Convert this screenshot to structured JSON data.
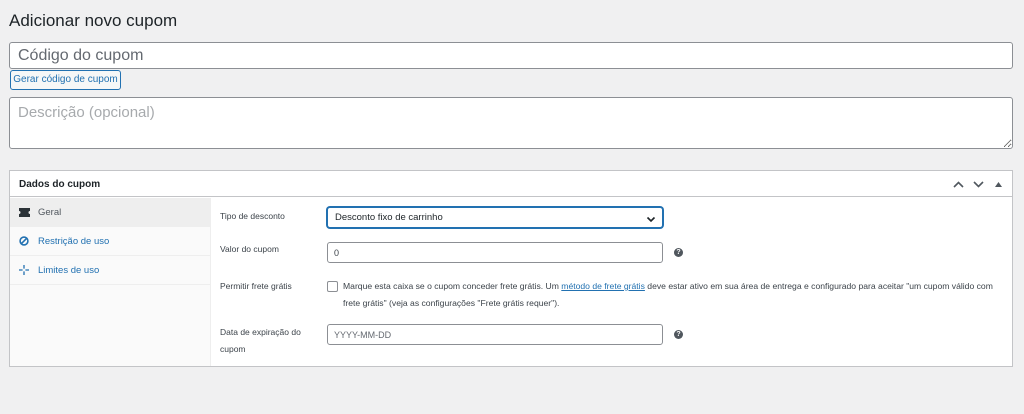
{
  "page": {
    "title": "Adicionar novo cupom",
    "code_placeholder": "Código do cupom",
    "generate_button": "Gerar código de cupom",
    "description_placeholder": "Descrição (opcional)"
  },
  "metabox": {
    "title": "Dados do cupom",
    "controls": [
      "chevron-up-icon",
      "chevron-down-icon",
      "triangle-up-icon"
    ]
  },
  "tabs": [
    {
      "label": "Geral",
      "icon": "ticket-icon",
      "active": true
    },
    {
      "label": "Restrição de uso",
      "icon": "block-icon",
      "active": false
    },
    {
      "label": "Limites de uso",
      "icon": "crosshair-icon",
      "active": false
    }
  ],
  "fields": {
    "discount_type": {
      "label": "Tipo de desconto",
      "value": "Desconto fixo de carrinho"
    },
    "amount": {
      "label": "Valor do cupom",
      "value": "0"
    },
    "free_shipping": {
      "label": "Permitir frete grátis",
      "text_before": "Marque esta caixa se o cupom conceder frete grátis. Um ",
      "link": "método de frete grátis",
      "text_after": " deve estar ativo em sua área de entrega e configurado para aceitar \"um cupom válido com frete grátis\" (veja as configurações \"Frete grátis requer\").",
      "checked": false
    },
    "expiry": {
      "label": "Data de expiração do cupom",
      "placeholder": "YYYY-MM-DD"
    }
  },
  "help_glyph": "?",
  "colors": {
    "accent": "#2271b1",
    "background": "#f0f0f1",
    "panel": "#ffffff",
    "tab_bg": "#fafafa"
  }
}
